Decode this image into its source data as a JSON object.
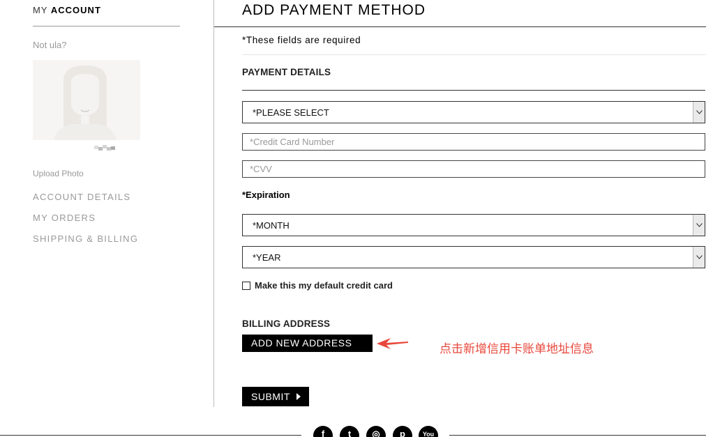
{
  "sidebar": {
    "title_prefix": "MY",
    "title_main": "ACCOUNT",
    "not_user": "Not ula?",
    "upload_photo": "Upload Photo",
    "links": [
      "ACCOUNT DETAILS",
      "MY ORDERS",
      "SHIPPING & BILLING"
    ]
  },
  "main": {
    "title": "ADD PAYMENT METHOD",
    "required_note": "*These fields are required",
    "payment_details_heading": "PAYMENT DETAILS",
    "card_type_select": "*PLEASE SELECT",
    "card_number_placeholder": "*Credit Card Number",
    "cvv_placeholder": "*CVV",
    "expiration_label": "*Expiration",
    "month_select": "*MONTH",
    "year_select": "*YEAR",
    "default_card_label": "Make this my default credit card",
    "billing_heading": "BILLING ADDRESS",
    "add_address_button": "ADD NEW ADDRESS",
    "submit_button": "SUBMIT"
  },
  "annotation": {
    "text": "点击新增信用卡账单地址信息",
    "color": "#e8483c"
  },
  "footer": {
    "social_icons": [
      "facebook-icon",
      "twitter-icon",
      "instagram-icon",
      "pinterest-icon",
      "youtube-icon"
    ],
    "social_glyphs": [
      "f",
      "t",
      "◎",
      "p",
      "You"
    ]
  }
}
